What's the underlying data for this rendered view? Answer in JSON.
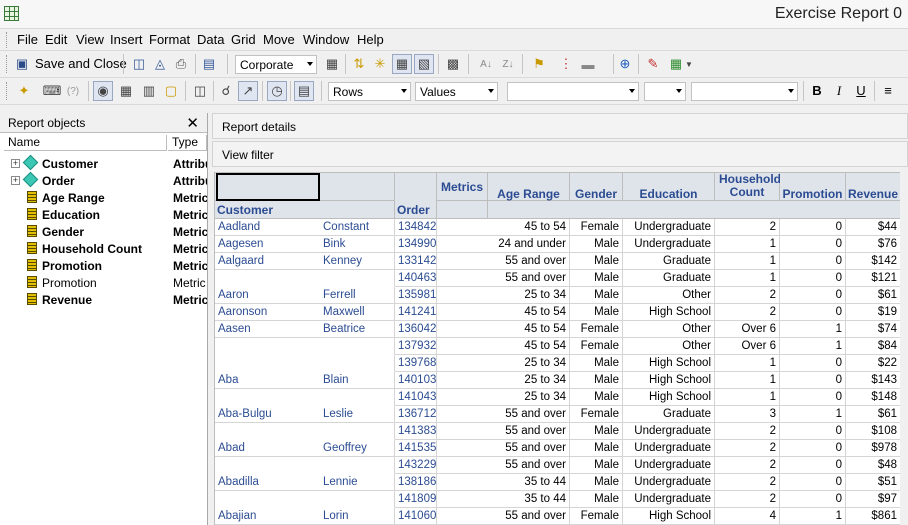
{
  "window": {
    "title": "Exercise Report 0"
  },
  "menubar": {
    "items": [
      "File",
      "Edit",
      "View",
      "Insert",
      "Format",
      "Data",
      "Grid",
      "Move",
      "Window",
      "Help"
    ]
  },
  "toolbar1": {
    "save_close_label": "Save and Close",
    "style_combo": "Corporate"
  },
  "toolbar2": {
    "rows_combo": "Rows",
    "values_combo": "Values",
    "font_combo": "",
    "size_combo": "",
    "color_combo": "",
    "bold": "B",
    "italic": "I",
    "underline": "U"
  },
  "left_panel": {
    "title": "Report objects",
    "columns": {
      "name": "Name",
      "type": "Type"
    },
    "objects": [
      {
        "name": "Customer",
        "type": "Attribute",
        "kind": "attribute",
        "bold": true
      },
      {
        "name": "Order",
        "type": "Attribute",
        "kind": "attribute",
        "bold": true
      },
      {
        "name": "Age Range",
        "type": "Metric",
        "kind": "metric",
        "bold": true
      },
      {
        "name": "Education",
        "type": "Metric",
        "kind": "metric",
        "bold": true
      },
      {
        "name": "Gender",
        "type": "Metric",
        "kind": "metric",
        "bold": true
      },
      {
        "name": "Household Count",
        "type": "Metric",
        "kind": "metric",
        "bold": true
      },
      {
        "name": "Promotion",
        "type": "Metric",
        "kind": "metric",
        "bold": true
      },
      {
        "name": "Promotion",
        "type": "Metric",
        "kind": "metric",
        "bold": false
      },
      {
        "name": "Revenue",
        "type": "Metric",
        "kind": "metric",
        "bold": true
      }
    ]
  },
  "report": {
    "details_label": "Report details",
    "view_filter_label": "View filter",
    "grid": {
      "row_header_customer": "Customer",
      "row_header_order": "Order",
      "metrics_label": "Metrics",
      "columns": [
        "Age Range",
        "Gender",
        "Education",
        "Household Count",
        "Promotion",
        "Revenue"
      ],
      "rows": [
        {
          "last": "Aadland",
          "first": "Constant",
          "order": "134842",
          "age": "45 to 54",
          "gender": "Female",
          "edu": "Undergraduate",
          "hh": "2",
          "promo": "0",
          "rev": "$44"
        },
        {
          "last": "Aagesen",
          "first": "Bink",
          "order": "134990",
          "age": "24 and under",
          "gender": "Male",
          "edu": "Undergraduate",
          "hh": "1",
          "promo": "0",
          "rev": "$76"
        },
        {
          "last": "Aalgaard",
          "first": "Kenney",
          "order": "133142",
          "age": "55 and over",
          "gender": "Male",
          "edu": "Graduate",
          "hh": "1",
          "promo": "0",
          "rev": "$142"
        },
        {
          "last": "",
          "first": "",
          "order": "140463",
          "age": "55 and over",
          "gender": "Male",
          "edu": "Graduate",
          "hh": "1",
          "promo": "0",
          "rev": "$121"
        },
        {
          "last": "Aaron",
          "first": "Ferrell",
          "order": "135981",
          "age": "25 to 34",
          "gender": "Male",
          "edu": "Other",
          "hh": "2",
          "promo": "0",
          "rev": "$61"
        },
        {
          "last": "Aaronson",
          "first": "Maxwell",
          "order": "141241",
          "age": "45 to 54",
          "gender": "Male",
          "edu": "High School",
          "hh": "2",
          "promo": "0",
          "rev": "$19"
        },
        {
          "last": "Aasen",
          "first": "Beatrice",
          "order": "136042",
          "age": "45 to 54",
          "gender": "Female",
          "edu": "Other",
          "hh": "Over 6",
          "promo": "1",
          "rev": "$74"
        },
        {
          "last": "",
          "first": "",
          "order": "137932",
          "age": "45 to 54",
          "gender": "Female",
          "edu": "Other",
          "hh": "Over 6",
          "promo": "1",
          "rev": "$84"
        },
        {
          "last": "",
          "first": "",
          "order": "139768",
          "age": "25 to 34",
          "gender": "Male",
          "edu": "High School",
          "hh": "1",
          "promo": "0",
          "rev": "$22"
        },
        {
          "last": "Aba",
          "first": "Blain",
          "order": "140103",
          "age": "25 to 34",
          "gender": "Male",
          "edu": "High School",
          "hh": "1",
          "promo": "0",
          "rev": "$143"
        },
        {
          "last": "",
          "first": "",
          "order": "141043",
          "age": "25 to 34",
          "gender": "Male",
          "edu": "High School",
          "hh": "1",
          "promo": "0",
          "rev": "$148"
        },
        {
          "last": "Aba-Bulgu",
          "first": "Leslie",
          "order": "136712",
          "age": "55 and over",
          "gender": "Female",
          "edu": "Graduate",
          "hh": "3",
          "promo": "1",
          "rev": "$61"
        },
        {
          "last": "",
          "first": "",
          "order": "141383",
          "age": "55 and over",
          "gender": "Male",
          "edu": "Undergraduate",
          "hh": "2",
          "promo": "0",
          "rev": "$108"
        },
        {
          "last": "Abad",
          "first": "Geoffrey",
          "order": "141535",
          "age": "55 and over",
          "gender": "Male",
          "edu": "Undergraduate",
          "hh": "2",
          "promo": "0",
          "rev": "$978"
        },
        {
          "last": "",
          "first": "",
          "order": "143229",
          "age": "55 and over",
          "gender": "Male",
          "edu": "Undergraduate",
          "hh": "2",
          "promo": "0",
          "rev": "$48"
        },
        {
          "last": "Abadilla",
          "first": "Lennie",
          "order": "138186",
          "age": "35 to 44",
          "gender": "Male",
          "edu": "Undergraduate",
          "hh": "2",
          "promo": "0",
          "rev": "$51"
        },
        {
          "last": "",
          "first": "",
          "order": "141809",
          "age": "35 to 44",
          "gender": "Male",
          "edu": "Undergraduate",
          "hh": "2",
          "promo": "0",
          "rev": "$97"
        },
        {
          "last": "Abajian",
          "first": "Lorin",
          "order": "141060",
          "age": "55 and over",
          "gender": "Female",
          "edu": "High School",
          "hh": "4",
          "promo": "1",
          "rev": "$861"
        }
      ]
    }
  }
}
